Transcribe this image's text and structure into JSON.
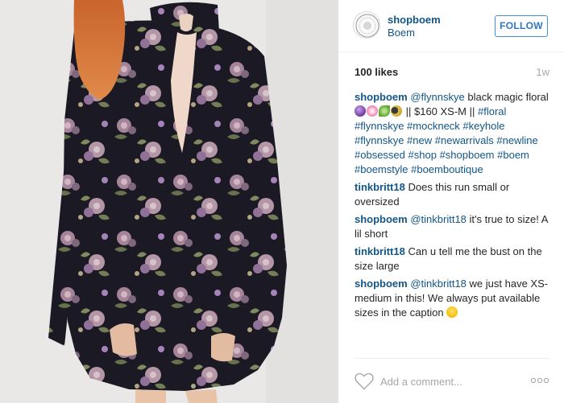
{
  "post": {
    "username": "shopboem",
    "location": "Boem",
    "follow_label": "FOLLOW",
    "likes": "100 likes",
    "time_ago": "1w"
  },
  "comments": [
    {
      "user": "shopboem",
      "mention": "@flynnskye",
      "text_before": " black magic floral ",
      "emojis": [
        "crystal-ball",
        "cherry-blossom",
        "herb",
        "moon"
      ],
      "text_price": " || $160 XS-M || ",
      "hashtags": [
        "#floral",
        "#flynnskye",
        "#mockneck",
        "#keyhole",
        "#flynnskye",
        "#new",
        "#newarrivals",
        "#newline",
        "#obsessed",
        "#shop",
        "#shopboem",
        "#boem",
        "#boemstyle",
        "#boemboutique"
      ]
    },
    {
      "user": "tinkbritt18",
      "text": "Does this run small or oversized"
    },
    {
      "user": "shopboem",
      "mention": "@tinkbritt18",
      "text": " it's true to size! A lil short"
    },
    {
      "user": "tinkbritt18",
      "text": "Can u tell me the bust on the size large"
    },
    {
      "user": "shopboem",
      "mention": "@tinkbritt18",
      "text": " we just have XS-medium in this! We always put available sizes in the caption "
    }
  ],
  "comment_box": {
    "placeholder": "Add a comment..."
  },
  "icons": {
    "avatar": "boem-logo-seal",
    "heart": "heart-icon",
    "more": "more-options-icon"
  },
  "colors": {
    "link_blue": "#125688",
    "follow_blue": "#4090db",
    "muted_gray": "#a5a7aa",
    "dress_base": "#1b1a24"
  }
}
